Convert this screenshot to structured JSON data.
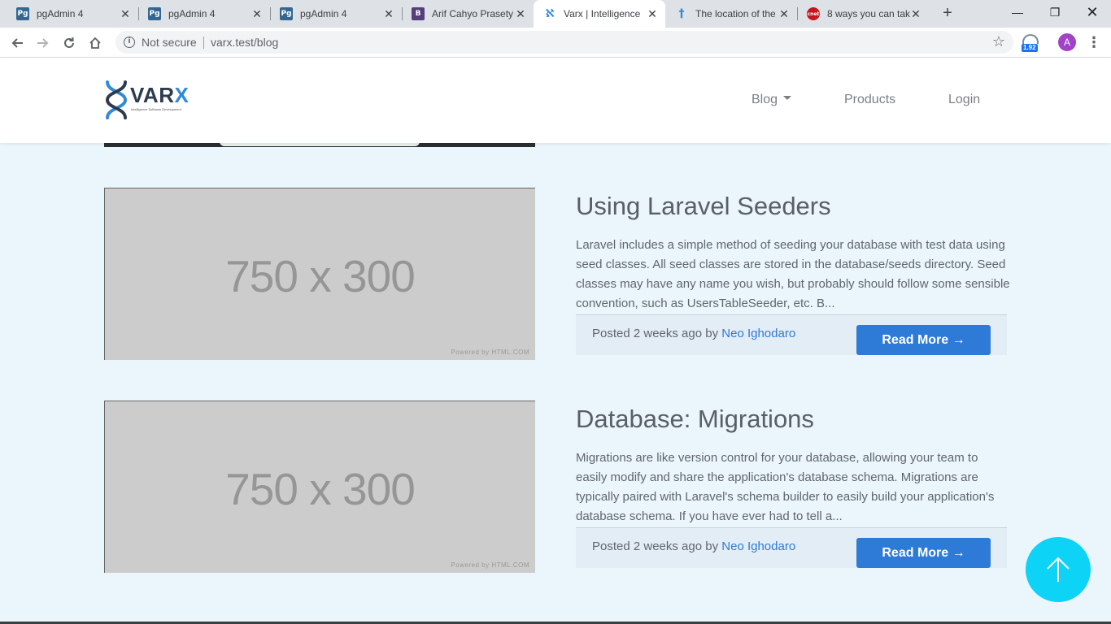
{
  "browser": {
    "tabs": [
      {
        "title": "pgAdmin 4",
        "favicon": "Pg",
        "favicon_color": "#336791"
      },
      {
        "title": "pgAdmin 4",
        "favicon": "Pg",
        "favicon_color": "#336791"
      },
      {
        "title": "pgAdmin 4",
        "favicon": "Pg",
        "favicon_color": "#336791"
      },
      {
        "title": "Arif Cahyo Prasety",
        "favicon": "B",
        "favicon_color": "#563d7c"
      },
      {
        "title": "Varx | Intelligence",
        "favicon": "varx",
        "favicon_color": "#2f8bd7"
      },
      {
        "title": "The location of the",
        "favicon": "†",
        "favicon_color": "#2f8bd7"
      },
      {
        "title": "8 ways you can tak",
        "favicon": "cnet",
        "favicon_color": "#c4161c"
      }
    ],
    "active_tab_index": 4,
    "security_label": "Not secure",
    "url": "varx.test/blog",
    "extension_badge": "1.92",
    "profile_initial": "A"
  },
  "site": {
    "logo_text_main": "VAR",
    "logo_text_accent": "X",
    "logo_tagline": "Intelligence Software Development",
    "nav": {
      "blog": "Blog",
      "products": "Products",
      "login": "Login"
    }
  },
  "posts": [
    {
      "image_text": "750 x 300",
      "image_credit": "Powered by HTML.COM",
      "title": "Using Laravel Seeders",
      "excerpt": "Laravel includes a simple method of seeding your database with test data using seed classes. All seed classes are stored in the database/seeds directory. Seed classes may have any name you wish, but probably should follow some sensible convention, such as UsersTableSeeder, etc. B...",
      "posted_prefix": "Posted 2 weeks ago by ",
      "author": "Neo Ighodaro",
      "read_more": "Read More →"
    },
    {
      "image_text": "750 x 300",
      "image_credit": "Powered by HTML.COM",
      "title": "Database: Migrations",
      "excerpt": "Migrations are like version control for your database, allowing your team to easily modify and share the application's database schema. Migrations are typically paired with Laravel's schema builder to easily build your application's database schema. If you have ever had to tell a...",
      "posted_prefix": "Posted 2 weeks ago by ",
      "author": "Neo Ighodaro",
      "read_more": "Read More →"
    }
  ],
  "colors": {
    "page_bg": "#eaf5fc",
    "brand_blue": "#2e7ad7",
    "back_to_top": "#0dd3f6"
  }
}
